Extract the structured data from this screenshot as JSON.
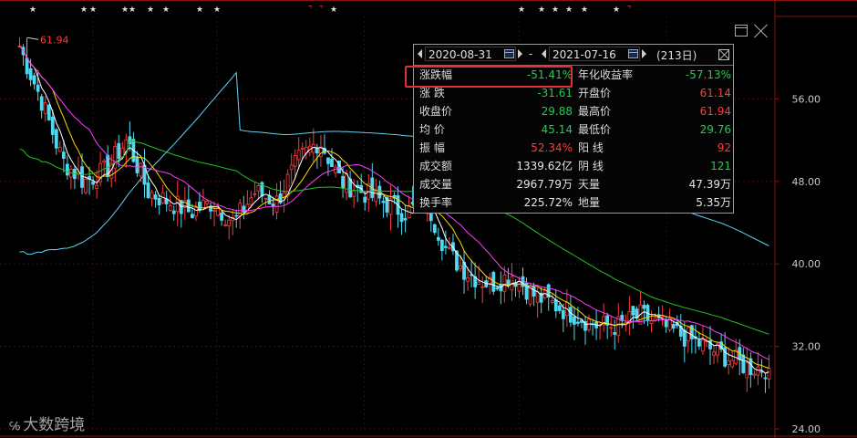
{
  "chart_data": {
    "type": "candlestick",
    "y_ticks": [
      "56.00",
      "48.00",
      "40.00",
      "32.00",
      "24.00"
    ],
    "y_tick_values": [
      56,
      48,
      40,
      32,
      24
    ],
    "ylim": [
      24,
      64
    ],
    "high_label": "61.94",
    "top_markers": [
      {
        "text": "★",
        "color": "#dddddd"
      },
      {
        "text": "★",
        "color": "#dddddd"
      },
      {
        "text": "★",
        "color": "#dddddd"
      },
      {
        "text": "★",
        "color": "#dddddd"
      },
      {
        "text": "★",
        "color": "#dddddd"
      },
      {
        "text": "★",
        "color": "#dddddd"
      },
      {
        "text": "★",
        "color": "#dddddd"
      },
      {
        "text": "★",
        "color": "#dddddd"
      },
      {
        "text": "★",
        "color": "#dddddd"
      },
      {
        "text": "⌝",
        "color": "#ff3b3b"
      },
      {
        "text": "⌝",
        "color": "#ff3b3b"
      },
      {
        "text": "★",
        "color": "#dddddd"
      },
      {
        "text": "★",
        "color": "#dddddd"
      },
      {
        "text": "★",
        "color": "#dddddd"
      },
      {
        "text": "★",
        "color": "#dddddd"
      },
      {
        "text": "★",
        "color": "#dddddd"
      },
      {
        "text": "★",
        "color": "#dddddd"
      },
      {
        "text": "★",
        "color": "#dddddd"
      },
      {
        "text": "⌝",
        "color": "#ff3b3b"
      }
    ],
    "close_anchor": [
      61,
      56,
      50,
      48,
      49,
      52,
      47,
      46,
      45,
      46,
      44,
      47,
      46,
      50,
      52,
      48,
      47,
      46,
      45,
      46,
      41,
      39,
      38,
      39,
      37,
      36,
      35,
      34,
      34,
      35,
      34,
      33,
      32,
      31,
      30,
      29.9
    ],
    "ma_colors": [
      "#ffffff",
      "#ffd700",
      "#ff3cff",
      "#22c322",
      "#5fd3f3"
    ]
  },
  "stats_panel": {
    "start_date": "2020-08-31",
    "end_date": "2021-07-16",
    "date_sep": "-",
    "days": "(213日)",
    "rows_left": [
      {
        "label": "涨跌幅",
        "value": "-51.41%",
        "color": "green"
      },
      {
        "label": "涨  跌",
        "value": "-31.61",
        "color": "green"
      },
      {
        "label": "收盘价",
        "value": "29.88",
        "color": "green"
      },
      {
        "label": "均  价",
        "value": "45.14",
        "color": "green"
      },
      {
        "label": "振  幅",
        "value": "52.34%",
        "color": "red"
      },
      {
        "label": "成交额",
        "value": "1339.62亿",
        "color": "white"
      },
      {
        "label": "成交量",
        "value": "2967.79万",
        "color": "white"
      },
      {
        "label": "换手率",
        "value": "225.72%",
        "color": "white"
      }
    ],
    "rows_right": [
      {
        "label": "年化收益率",
        "value": "-57.13%",
        "color": "green"
      },
      {
        "label": "开盘价",
        "value": "61.14",
        "color": "red"
      },
      {
        "label": "最高价",
        "value": "61.94",
        "color": "red"
      },
      {
        "label": "最低价",
        "value": "29.76",
        "color": "green"
      },
      {
        "label": "阳  线",
        "value": "92",
        "color": "red"
      },
      {
        "label": "阴  线",
        "value": "121",
        "color": "green"
      },
      {
        "label": "天量",
        "value": "47.39万",
        "color": "white"
      },
      {
        "label": "地量",
        "value": "5.35万",
        "color": "white"
      }
    ]
  },
  "watermark": {
    "logo": "℅",
    "text": "大数跨境"
  }
}
